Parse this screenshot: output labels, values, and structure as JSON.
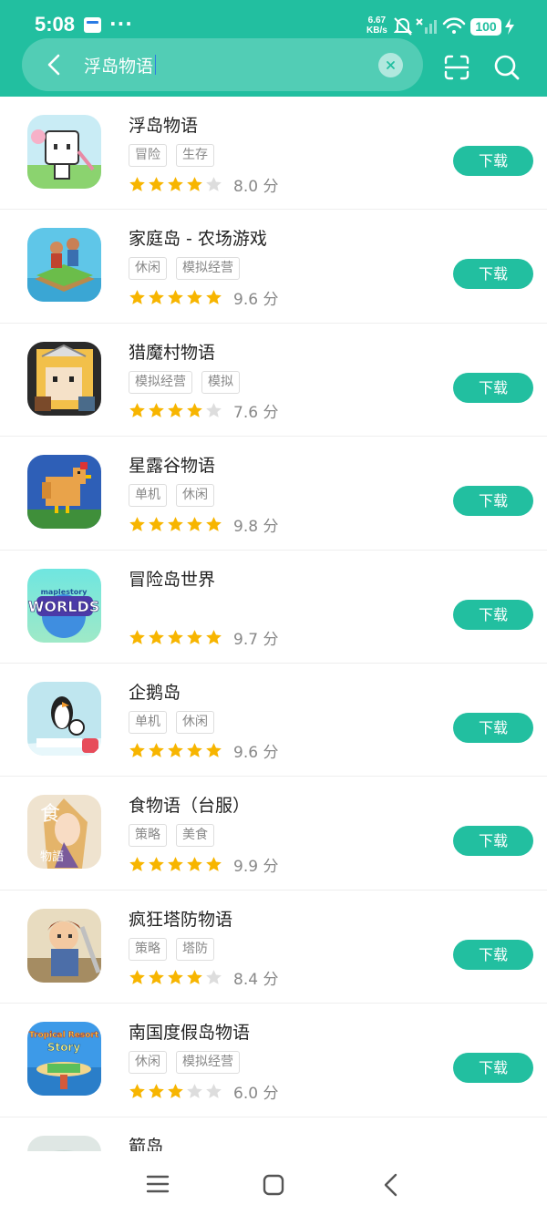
{
  "status": {
    "time": "5:08",
    "dots": "···",
    "speed_value": "6.67",
    "speed_unit": "KB/s",
    "battery": "100"
  },
  "search": {
    "query": "浮岛物语"
  },
  "download_label": "下载",
  "score_unit": "分",
  "colors": {
    "accent": "#22bfa0",
    "star": "#f7b500",
    "star_empty": "#dddddd"
  },
  "apps": [
    {
      "name": "浮岛物语",
      "tags": [
        "冒险",
        "生存"
      ],
      "stars": 4,
      "score": "8.0 分",
      "icon": "island-tale-icon"
    },
    {
      "name": "家庭岛 - 农场游戏",
      "tags": [
        "休闲",
        "模拟经营"
      ],
      "stars": 5,
      "score": "9.6 分",
      "icon": "family-island-icon"
    },
    {
      "name": "猎魔村物语",
      "tags": [
        "模拟经营",
        "模拟"
      ],
      "stars": 4,
      "score": "7.6 分",
      "icon": "monster-village-icon"
    },
    {
      "name": "星露谷物语",
      "tags": [
        "单机",
        "休闲"
      ],
      "stars": 5,
      "score": "9.8 分",
      "icon": "stardew-chicken-icon"
    },
    {
      "name": "冒险岛世界",
      "tags": [],
      "stars": 5,
      "score": "9.7 分",
      "icon": "maplestory-worlds-icon",
      "icon_text_top": "maplestory",
      "icon_text_main": "WORLDS"
    },
    {
      "name": "企鹅岛",
      "tags": [
        "单机",
        "休闲"
      ],
      "stars": 5,
      "score": "9.6 分",
      "icon": "penguin-isle-icon"
    },
    {
      "name": "食物语（台服）",
      "tags": [
        "策略",
        "美食"
      ],
      "stars": 5,
      "score": "9.9 分",
      "icon": "food-fantasy-icon",
      "icon_text_top": "食",
      "icon_text_main": "物語"
    },
    {
      "name": "疯狂塔防物语",
      "tags": [
        "策略",
        "塔防"
      ],
      "stars": 4,
      "score": "8.4 分",
      "icon": "tower-defense-hero-icon"
    },
    {
      "name": "南国度假岛物语",
      "tags": [
        "休闲",
        "模拟经营"
      ],
      "stars": 3,
      "score": "6.0 分",
      "icon": "tropical-resort-icon",
      "icon_text_top": "Tropical Resort",
      "icon_text_main": "Story"
    },
    {
      "name": "箭岛",
      "tags": [],
      "stars": 0,
      "score": "",
      "icon": "arrow-island-icon"
    }
  ]
}
